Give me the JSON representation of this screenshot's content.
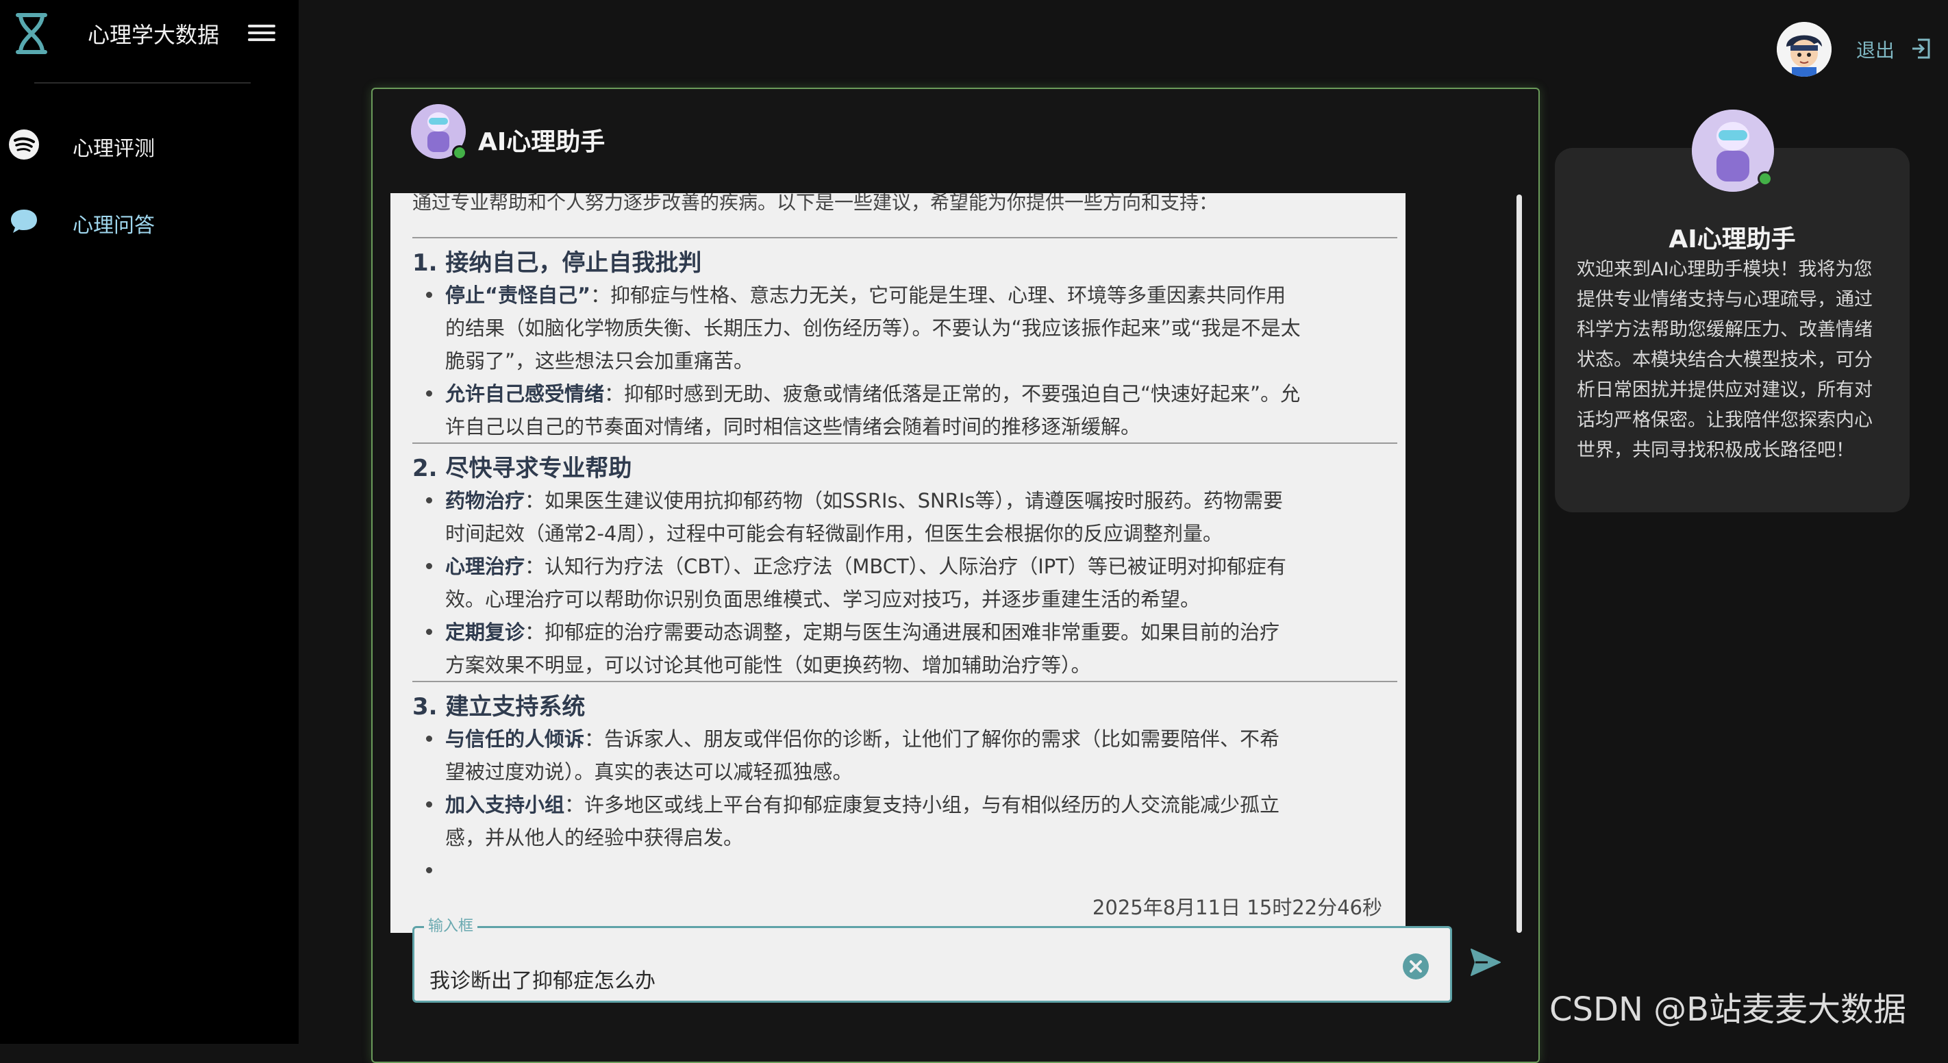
{
  "sidebar": {
    "brand_title": "心理学大数据",
    "items": [
      {
        "label": "心理评测"
      },
      {
        "label": "心理问答"
      }
    ]
  },
  "header": {
    "logout_label": "退出"
  },
  "chat": {
    "title": "AI心理助手",
    "intro": "通过专业帮助和个人努力逐步改善的疾病。以下是一些建议，希望能为你提供一些方向和支持：",
    "sections": [
      {
        "heading": "1. 接纳自己，停止自我批判",
        "points": [
          {
            "bold": "停止“责怪自己”",
            "lines": [
              "：抑郁症与性格、意志力无关，它可能是生理、心理、环境等多重因素共同作用",
              "的结果（如脑化学物质失衡、长期压力、创伤经历等）。不要认为“我应该振作起来”或“我是不是太",
              "脆弱了”，这些想法只会加重痛苦。"
            ]
          },
          {
            "bold": "允许自己感受情绪",
            "lines": [
              "：抑郁时感到无助、疲惫或情绪低落是正常的，不要强迫自己“快速好起来”。允",
              "许自己以自己的节奏面对情绪，同时相信这些情绪会随着时间的推移逐渐缓解。"
            ]
          }
        ]
      },
      {
        "heading": "2. 尽快寻求专业帮助",
        "points": [
          {
            "bold": "药物治疗",
            "lines": [
              "：如果医生建议使用抗抑郁药物（如SSRIs、SNRIs等），请遵医嘱按时服药。药物需要",
              "时间起效（通常2-4周），过程中可能会有轻微副作用，但医生会根据你的反应调整剂量。"
            ]
          },
          {
            "bold": "心理治疗",
            "lines": [
              "：认知行为疗法（CBT）、正念疗法（MBCT）、人际治疗（IPT）等已被证明对抑郁症有",
              "效。心理治疗可以帮助你识别负面思维模式、学习应对技巧，并逐步重建生活的希望。"
            ]
          },
          {
            "bold": "定期复诊",
            "lines": [
              "：抑郁症的治疗需要动态调整，定期与医生沟通进展和困难非常重要。如果目前的治疗",
              "方案效果不明显，可以讨论其他可能性（如更换药物、增加辅助治疗等）。"
            ]
          }
        ]
      },
      {
        "heading": "3. 建立支持系统",
        "points": [
          {
            "bold": "与信任的人倾诉",
            "lines": [
              "：告诉家人、朋友或伴侣你的诊断，让他们了解你的需求（比如需要陪伴、不希",
              "望被过度劝说）。真实的表达可以减轻孤独感。"
            ]
          },
          {
            "bold": "加入支持小组",
            "lines": [
              "：许多地区或线上平台有抑郁症康复支持小组，与有相似经历的人交流能减少孤立",
              "感，并从他人的经验中获得启发。"
            ]
          }
        ]
      }
    ],
    "timestamp": "2025年8月11日 15时22分46秒",
    "input": {
      "legend": "输入框",
      "value": "我诊断出了抑郁症怎么办"
    }
  },
  "info_card": {
    "title": "AI心理助手",
    "text": "欢迎来到AI心理助手模块！我将为您提供专业情绪支持与心理疏导，通过科学方法帮助您缓解压力、改善情绪状态。本模块结合大模型技术，可分析日常困扰并提供应对建议，所有对话均严格保密。让我陪伴您探索内心世界，共同寻找积极成长路径吧！"
  },
  "watermark": "CSDN @B站麦麦大数据",
  "colors": {
    "accent_teal": "#5fa3a8",
    "chat_border": "#6a9a5a",
    "online": "#43b047",
    "nav_active": "#9fd7ee"
  }
}
